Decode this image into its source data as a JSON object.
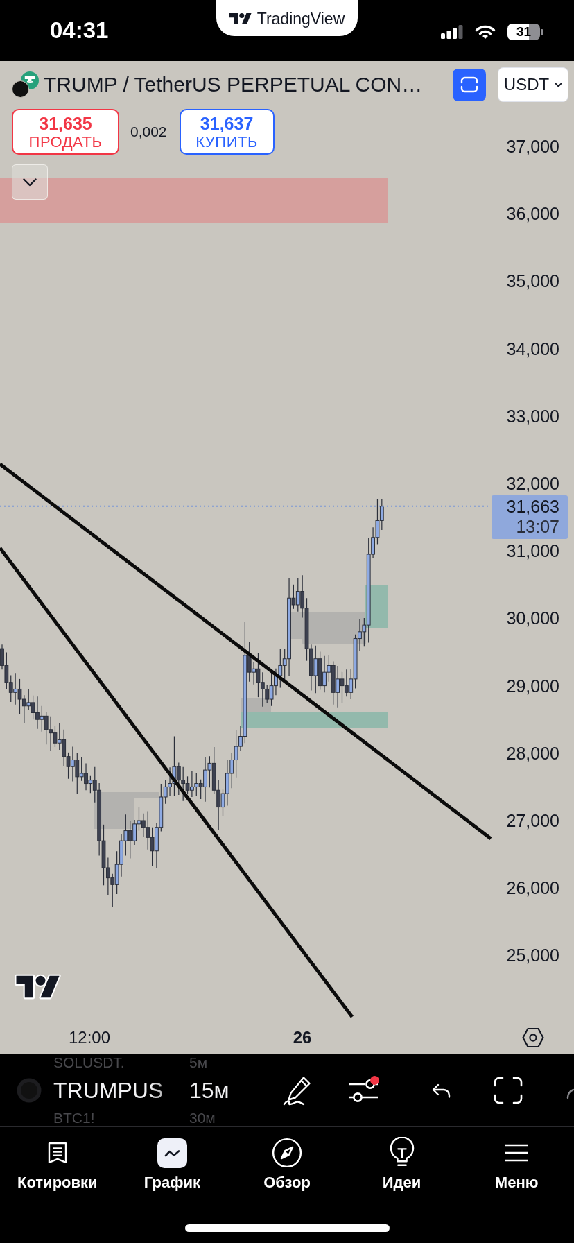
{
  "status_bar": {
    "time": "04:31",
    "battery": "31"
  },
  "app_badge": {
    "name": "TradingView"
  },
  "symbol_header": {
    "title": "TRUMP / TetherUS PERPETUAL CON…",
    "currency": "USDT"
  },
  "quote": {
    "sell": {
      "price": "31,635",
      "label": "ПРОДАТЬ"
    },
    "spread": "0,002",
    "buy": {
      "price": "31,637",
      "label": "КУПИТЬ"
    }
  },
  "chart": {
    "price_axis": [
      "37,000",
      "36,000",
      "35,000",
      "34,000",
      "33,000",
      "32,000",
      "31,000",
      "30,000",
      "29,000",
      "28,000",
      "27,000",
      "26,000",
      "25,000"
    ],
    "last_price": {
      "price": "31,663",
      "countdown": "13:07"
    },
    "time_axis": [
      {
        "label": "12:00",
        "kind": "time"
      },
      {
        "label": "26",
        "kind": "day"
      }
    ]
  },
  "toolbar": {
    "symbols": [
      {
        "symbol": "SOLUSDT.",
        "interval": "5м",
        "selected": false
      },
      {
        "symbol": "TRUMPUS",
        "interval": "15м",
        "selected": true
      },
      {
        "symbol": "BTC1!",
        "interval": "30м",
        "selected": false
      }
    ],
    "has_alert": true
  },
  "tabs": [
    {
      "label": "Котировки",
      "kind": "quotes",
      "selected": false
    },
    {
      "label": "График",
      "kind": "chart",
      "selected": true
    },
    {
      "label": "Обзор",
      "kind": "explore",
      "selected": false
    },
    {
      "label": "Идеи",
      "kind": "ideas",
      "selected": false
    },
    {
      "label": "Меню",
      "kind": "menu",
      "selected": false
    }
  ]
}
